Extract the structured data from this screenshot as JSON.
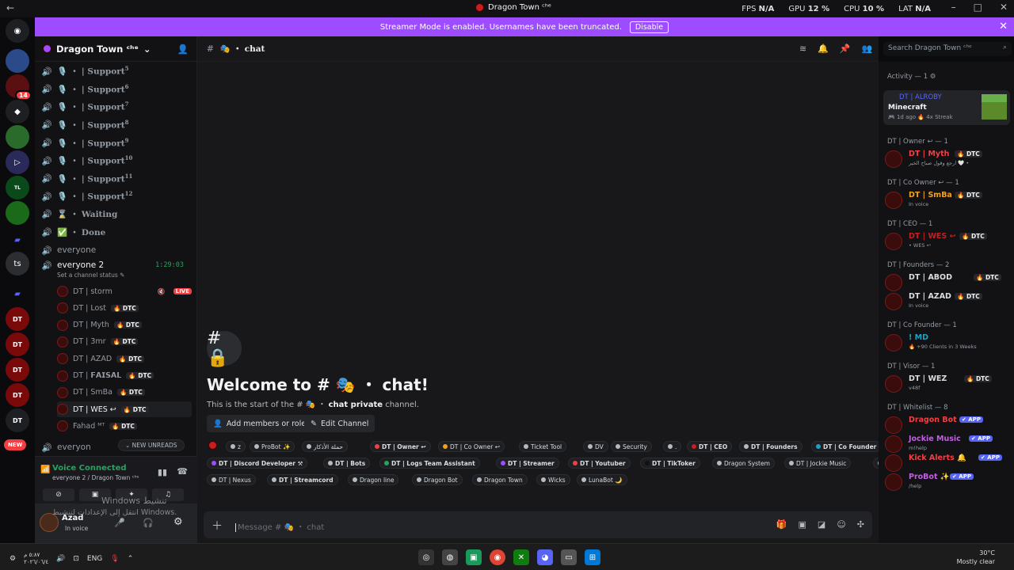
{
  "topbar": {
    "title": "Dragon Town ᶜʰᵉ",
    "fps_label": "FPS",
    "fps": "N/A",
    "gpu_label": "GPU",
    "gpu": "12 %",
    "cpu_label": "CPU",
    "cpu": "10 %",
    "lat_label": "LAT",
    "lat": "N/A"
  },
  "banner": {
    "text": "Streamer Mode is enabled. Usernames have been truncated.",
    "disable": "Disable"
  },
  "servers": {
    "badge": "14",
    "ts": "ts",
    "new": "NEW"
  },
  "guild": {
    "name": "Dragon Town ᶜʰᵉ"
  },
  "channels": [
    {
      "name": "Support",
      "sup": "5",
      "icon": "speaker-icon"
    },
    {
      "name": "Support",
      "sup": "6",
      "icon": "speaker-icon"
    },
    {
      "name": "Support",
      "sup": "7",
      "icon": "speaker-icon"
    },
    {
      "name": "Support",
      "sup": "8",
      "icon": "speaker-icon"
    },
    {
      "name": "Support",
      "sup": "9",
      "icon": "speaker-icon"
    },
    {
      "name": "Support",
      "sup": "10",
      "icon": "speaker-icon"
    },
    {
      "name": "Support",
      "sup": "11",
      "icon": "speaker-icon"
    },
    {
      "name": "Support",
      "sup": "12",
      "icon": "speaker-icon"
    },
    {
      "name": "⌛ ・ Waiting"
    },
    {
      "name": "✅ ・ Done"
    },
    {
      "name": "everyone"
    }
  ],
  "support_prefix": "🎙️ ・ | ",
  "active_channel": {
    "name": "everyone 2",
    "timer": "1:29:03",
    "status": "Set a channel status ✎"
  },
  "voice_users": [
    {
      "name": "DT | storm",
      "live": "LIVE"
    },
    {
      "name": "DT | Lost",
      "dtc": "🔥 DTC"
    },
    {
      "name": "DT | Myth",
      "dtc": "🔥 DTC"
    },
    {
      "name": "DT | 3mr",
      "dtc": "🔥 DTC"
    },
    {
      "name": "DT | AZAD",
      "dtc": "🔥 DTC"
    },
    {
      "name": "DT | 𝗙𝗔𝗜𝗦𝗔𝗟",
      "dtc": "🔥 DTC"
    },
    {
      "name": "DT | SmBa",
      "dtc": "🔥 DTC"
    },
    {
      "name": "DT | WES ↩",
      "dtc": "🔥 DTC"
    },
    {
      "name": "Fahad ᴹᵀ",
      "dtc": "🔥 DTC"
    }
  ],
  "next_channel": "everyon",
  "new_unreads": "⌄ NEW UNREADS",
  "voice_panel": {
    "title": "Voice Connected",
    "sub": "everyone 2 / Dragon Town ᶜʰᵉ"
  },
  "user": {
    "name": "Azad",
    "status": "In voice"
  },
  "watermark": {
    "line1": "Windows تنشيط",
    "line2": "انتقل إلى الإعدادات لتنشيط Windows."
  },
  "main": {
    "channel": "🎭 ・ chat",
    "search": "Search Dragon Town ᶜʰᵉ",
    "welcome": "Welcome to # 🎭 ・ chat!",
    "start_pre": "This is the start of the # 🎭 ・ ",
    "start_bold": "chat private",
    "start_post": " channel.",
    "add_members": "Add members or roles",
    "edit_channel": "Edit Channel",
    "placeholder": "Message # 🎭 ・ chat"
  },
  "tags": [
    {
      "t": "z",
      "c": "#b5bac1"
    },
    {
      "t": "ProBot ✨",
      "c": "#b5bac1"
    },
    {
      "t": "حملة الأذكار",
      "c": "#b5bac1"
    },
    {
      "t": "DT | Owner ↩",
      "c": "#f23f43",
      "b": true
    },
    {
      "t": "DT | Co Owner ↩",
      "c": "#f0a020",
      "b": false
    },
    {
      "t": "Ticket Tool",
      "c": "#b5bac1"
    },
    {
      "t": "DV",
      "c": "#b5bac1"
    },
    {
      "t": "Security",
      "c": "#b5bac1"
    },
    {
      "t": ".",
      "c": "#b5bac1"
    },
    {
      "t": "DT | CEO",
      "c": "#c81e1e",
      "b": true
    },
    {
      "t": "DT | Founders",
      "c": "#b5bac1",
      "b": true
    },
    {
      "t": "DT | Co Founder",
      "c": "#20a0c0",
      "b": true
    },
    {
      "t": "DT | Discord Developer ⚒",
      "c": "#9d4dff",
      "b": true
    },
    {
      "t": "DT | Bots",
      "c": "#b5bac1",
      "b": true
    },
    {
      "t": "DT | Logs Team Assistant",
      "c": "#23a55a",
      "b": true
    },
    {
      "t": "DT | Streamer",
      "c": "#9d4dff",
      "b": true
    },
    {
      "t": "DT | Youtuber",
      "c": "#f23f43",
      "b": true
    },
    {
      "t": "DT | TikToker",
      "c": "#111111",
      "b": true
    },
    {
      "t": "Dragon System",
      "c": "#b5bac1"
    },
    {
      "t": "DT | Jockie Music",
      "c": "#b5bac1"
    },
    {
      "t": "DT | Kick Alerts 🔔",
      "c": "#b5bac1"
    },
    {
      "t": "DT | Nexus",
      "c": "#b5bac1"
    },
    {
      "t": "DT | Streamcord",
      "c": "#b5bac1",
      "b": true
    },
    {
      "t": "Dragon line",
      "c": "#b5bac1"
    },
    {
      "t": "Dragon Bot",
      "c": "#b5bac1"
    },
    {
      "t": "Dragon Town",
      "c": "#b5bac1"
    },
    {
      "t": "Wicks",
      "c": "#b5bac1"
    },
    {
      "t": "LunaBot 🌙",
      "c": "#b5bac1"
    }
  ],
  "members": {
    "activity": "Activity — 1 ⚙",
    "activity_card": {
      "user": "DT | ALROBY",
      "game": "Minecraft",
      "meta": "🎮 1d ago  🔥 4x Streak"
    },
    "sections": [
      {
        "title": "DT | Owner ↩ — 1",
        "members": [
          {
            "name": "DT | Myth",
            "sub": "ارجع وقول صباح الخير 🤍 •",
            "color": "#f23f43",
            "dtc": "🔥 DTC"
          }
        ]
      },
      {
        "title": "DT | Co Owner ↩ — 1",
        "members": [
          {
            "name": "DT | SmBa",
            "sub": "In voice",
            "color": "#f0a020",
            "dtc": "🔥 DTC"
          }
        ]
      },
      {
        "title": "DT | CEO — 1",
        "members": [
          {
            "name": "DT | WES ↩",
            "sub": "• WES ↩",
            "color": "#c81e1e",
            "dtc": "🔥 DTC"
          }
        ]
      },
      {
        "title": "DT | Founders — 2",
        "members": [
          {
            "name": "DT | 𝗔𝗕𝗢𝗗",
            "sub": "",
            "color": "#dbdee1",
            "dtc": "🔥 DTC"
          },
          {
            "name": "DT | AZAD",
            "sub": "In voice",
            "color": "#dbdee1",
            "dtc": "🔥 DTC"
          }
        ]
      },
      {
        "title": "DT | Co Founder — 1",
        "members": [
          {
            "name": "! MD",
            "sub": "🔥 +90 Clients in 3 Weeks",
            "color": "#20a0c0"
          }
        ]
      },
      {
        "title": "DT | Visor — 1",
        "members": [
          {
            "name": "DT | 𝗪𝗘𝗭",
            "sub": "v48f",
            "color": "#dbdee1",
            "dtc": "🔥 DTC"
          }
        ]
      },
      {
        "title": "DT | Whitelist — 8",
        "members": [
          {
            "name": "Dragon Bot",
            "sub": "",
            "color": "#f23f43",
            "app": "✔ APP"
          },
          {
            "name": "Jockie Music",
            "sub": "m!help",
            "color": "#c060e0",
            "app": "✔ APP"
          },
          {
            "name": "Kick Alerts 🔔",
            "sub": "",
            "color": "#f23f43",
            "app": "✔ APP"
          },
          {
            "name": "ProBot ✨",
            "sub": "/help",
            "color": "#c060e0",
            "app": "✔ APP"
          }
        ]
      }
    ]
  },
  "taskbar": {
    "time1": "٥:٨٧ م",
    "date": "٢٠٢٦/٠٦/٤",
    "lang": "ENG",
    "temp": "30°C",
    "weather": "Mostly clear"
  }
}
